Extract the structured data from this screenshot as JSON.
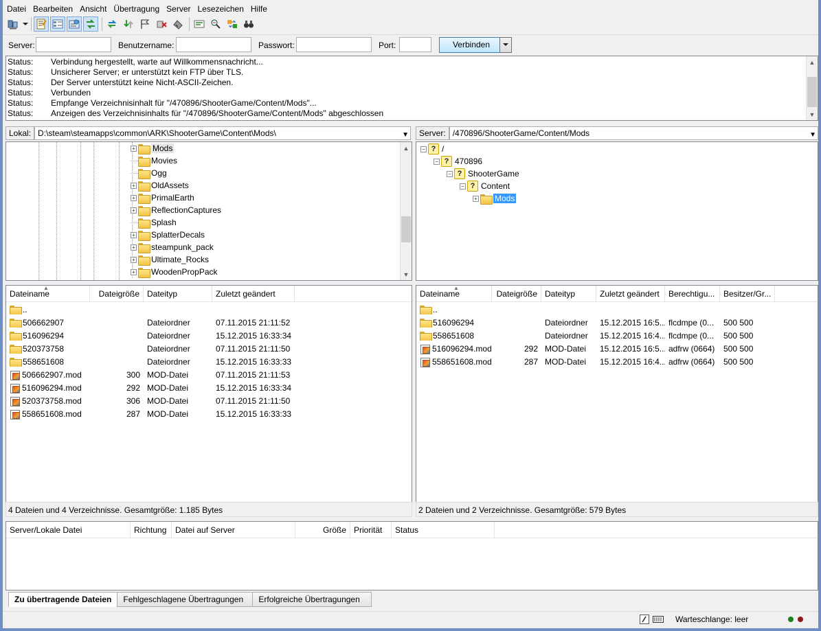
{
  "menu": [
    "Datei",
    "Bearbeiten",
    "Ansicht",
    "Übertragung",
    "Server",
    "Lesezeichen",
    "Hilfe"
  ],
  "toolbar": {
    "icons": [
      "site-manager-icon",
      "dropdown-caret-icon",
      "message-log-toggle-icon",
      "local-tree-toggle-icon",
      "remote-tree-toggle-icon",
      "queue-toggle-icon",
      "refresh-icon",
      "process-queue-icon",
      "cancel-icon",
      "disconnect-icon",
      "reconnect-icon",
      "directory-filter-icon",
      "compare-icon",
      "sync-browse-icon",
      "search-icon"
    ]
  },
  "quickconnect": {
    "server_label": "Server:",
    "user_label": "Benutzername:",
    "password_label": "Passwort:",
    "port_label": "Port:",
    "server_value": "",
    "user_value": "",
    "password_value": "",
    "port_value": "",
    "connect_button": "Verbinden"
  },
  "log": [
    {
      "k": "Status:",
      "v": "Verbindung hergestellt, warte auf Willkommensnachricht..."
    },
    {
      "k": "Status:",
      "v": "Unsicherer Server; er unterstützt kein FTP über TLS."
    },
    {
      "k": "Status:",
      "v": "Der Server unterstützt keine Nicht-ASCII-Zeichen."
    },
    {
      "k": "Status:",
      "v": "Verbunden"
    },
    {
      "k": "Status:",
      "v": "Empfange Verzeichnisinhalt für \"/470896/ShooterGame/Content/Mods\"..."
    },
    {
      "k": "Status:",
      "v": "Anzeigen des Verzeichnisinhalts für \"/470896/ShooterGame/Content/Mods\" abgeschlossen"
    }
  ],
  "local": {
    "label": "Lokal:",
    "path": "D:\\steam\\steamapps\\common\\ARK\\ShooterGame\\Content\\Mods\\",
    "tree": [
      {
        "name": "Mods",
        "expander": "+"
      },
      {
        "name": "Movies",
        "expander": ""
      },
      {
        "name": "Ogg",
        "expander": ""
      },
      {
        "name": "OldAssets",
        "expander": "+"
      },
      {
        "name": "PrimalEarth",
        "expander": "+"
      },
      {
        "name": "ReflectionCaptures",
        "expander": "+"
      },
      {
        "name": "Splash",
        "expander": ""
      },
      {
        "name": "SplatterDecals",
        "expander": "+"
      },
      {
        "name": "steampunk_pack",
        "expander": "+"
      },
      {
        "name": "Ultimate_Rocks",
        "expander": "+"
      },
      {
        "name": "WoodenPropPack",
        "expander": "+"
      }
    ],
    "columns": [
      "Dateiname",
      "Dateigröße",
      "Dateityp",
      "Zuletzt geändert"
    ],
    "files": [
      {
        "name": "..",
        "size": "",
        "type": "",
        "modified": "",
        "icon": "folder"
      },
      {
        "name": "506662907",
        "size": "",
        "type": "Dateiordner",
        "modified": "07.11.2015 21:11:52",
        "icon": "folder"
      },
      {
        "name": "516096294",
        "size": "",
        "type": "Dateiordner",
        "modified": "15.12.2015 16:33:34",
        "icon": "folder"
      },
      {
        "name": "520373758",
        "size": "",
        "type": "Dateiordner",
        "modified": "07.11.2015 21:11:50",
        "icon": "folder"
      },
      {
        "name": "558651608",
        "size": "",
        "type": "Dateiordner",
        "modified": "15.12.2015 16:33:33",
        "icon": "folder"
      },
      {
        "name": "506662907.mod",
        "size": "300",
        "type": "MOD-Datei",
        "modified": "07.11.2015 21:11:53",
        "icon": "mod"
      },
      {
        "name": "516096294.mod",
        "size": "292",
        "type": "MOD-Datei",
        "modified": "15.12.2015 16:33:34",
        "icon": "mod"
      },
      {
        "name": "520373758.mod",
        "size": "306",
        "type": "MOD-Datei",
        "modified": "07.11.2015 21:11:50",
        "icon": "mod"
      },
      {
        "name": "558651608.mod",
        "size": "287",
        "type": "MOD-Datei",
        "modified": "15.12.2015 16:33:33",
        "icon": "mod"
      }
    ],
    "status": "4 Dateien und 4 Verzeichnisse. Gesamtgröße: 1.185 Bytes"
  },
  "remote": {
    "label": "Server:",
    "path": "/470896/ShooterGame/Content/Mods",
    "tree": [
      {
        "name": "/",
        "icon": "question"
      },
      {
        "name": "470896",
        "icon": "question"
      },
      {
        "name": "ShooterGame",
        "icon": "question"
      },
      {
        "name": "Content",
        "icon": "question"
      },
      {
        "name": "Mods",
        "icon": "folder"
      }
    ],
    "columns": [
      "Dateiname",
      "Dateigröße",
      "Dateityp",
      "Zuletzt geändert",
      "Berechtigu...",
      "Besitzer/Gr..."
    ],
    "files": [
      {
        "name": "..",
        "size": "",
        "type": "",
        "modified": "",
        "perm": "",
        "owner": "",
        "icon": "folder"
      },
      {
        "name": "516096294",
        "size": "",
        "type": "Dateiordner",
        "modified": "15.12.2015 16:5...",
        "perm": "flcdmpe (0...",
        "owner": "500 500",
        "icon": "folder"
      },
      {
        "name": "558651608",
        "size": "",
        "type": "Dateiordner",
        "modified": "15.12.2015 16:4...",
        "perm": "flcdmpe (0...",
        "owner": "500 500",
        "icon": "folder"
      },
      {
        "name": "516096294.mod",
        "size": "292",
        "type": "MOD-Datei",
        "modified": "15.12.2015 16:5...",
        "perm": "adfrw (0664)",
        "owner": "500 500",
        "icon": "mod"
      },
      {
        "name": "558651608.mod",
        "size": "287",
        "type": "MOD-Datei",
        "modified": "15.12.2015 16:4...",
        "perm": "adfrw (0664)",
        "owner": "500 500",
        "icon": "mod"
      }
    ],
    "status": "2 Dateien und 2 Verzeichnisse. Gesamtgröße: 579 Bytes"
  },
  "queue": {
    "columns": [
      "Server/Lokale Datei",
      "Richtung",
      "Datei auf Server",
      "Größe",
      "Priorität",
      "Status"
    ]
  },
  "tabs": [
    "Zu übertragende Dateien",
    "Fehlgeschlagene Übertragungen",
    "Erfolgreiche Übertragungen"
  ],
  "statusbar": {
    "queue": "Warteschlange: leer",
    "led_colors": [
      "#1e7d1e",
      "#8b1a1a"
    ]
  }
}
